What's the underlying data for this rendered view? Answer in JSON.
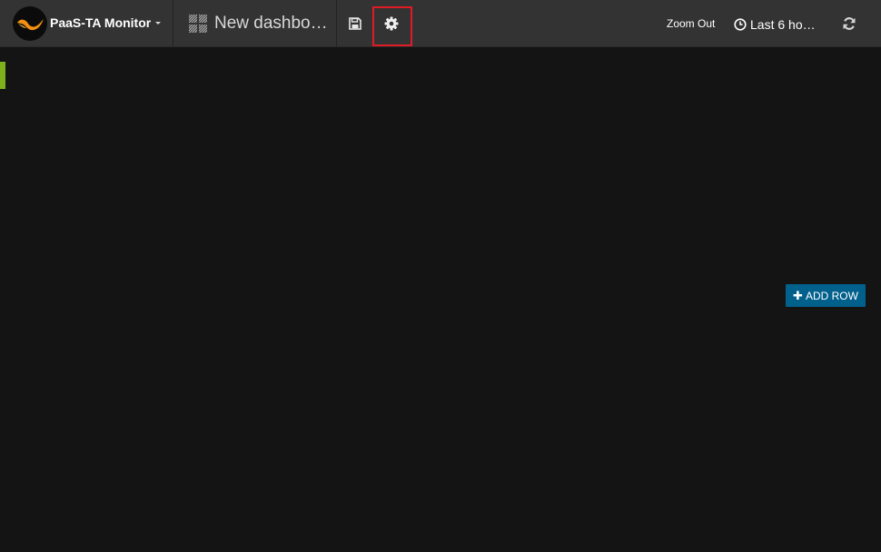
{
  "header": {
    "brand_label": "PaaS-TA Monitor",
    "dashboard_title": "New dashbo…",
    "zoom_out_label": "Zoom Out",
    "time_range_label": "Last 6 ho…",
    "icons": {
      "logo": "paas-ta-logo",
      "dashboard": "dashboard-grid-icon",
      "save": "save-icon",
      "settings": "gear-icon",
      "time": "clock-icon",
      "refresh": "refresh-icon"
    },
    "highlight_color": "#e01b24"
  },
  "main": {
    "add_row_label": "ADD ROW",
    "row_marker_color": "#7eb01e",
    "add_row_color": "#02608c"
  },
  "colors": {
    "topbar": "#333333",
    "background": "#141414"
  }
}
